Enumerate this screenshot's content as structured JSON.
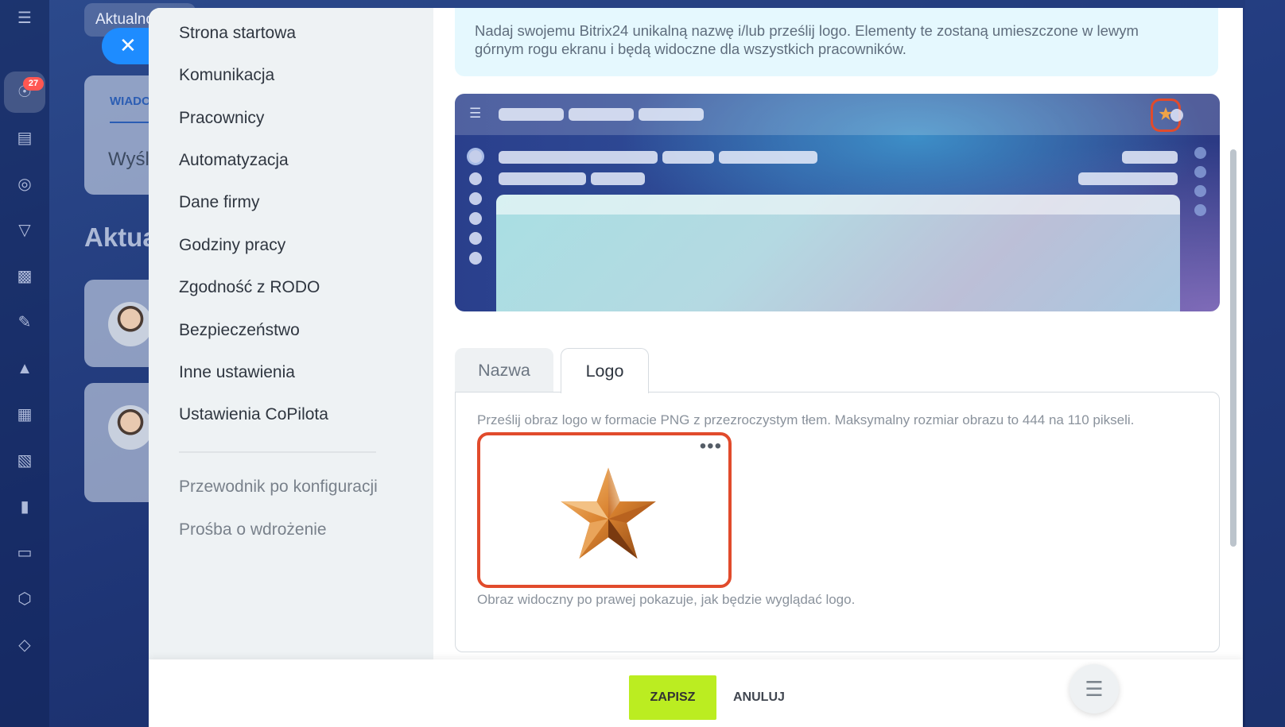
{
  "background": {
    "chip_label": "Aktualności",
    "card_tab_label": "WIADOMOŚCI",
    "card_text": "Wyślij wiadomość",
    "heading": "Aktualności",
    "notification_count": "27"
  },
  "menu": {
    "items": [
      "Strona startowa",
      "Komunikacja",
      "Pracownicy",
      "Automatyzacja",
      "Dane firmy",
      "Godziny pracy",
      "Zgodność z RODO",
      "Bezpieczeństwo",
      "Inne ustawienia",
      "Ustawienia CoPilota"
    ],
    "secondary_items": [
      "Przewodnik po konfiguracji",
      "Prośba o wdrożenie"
    ]
  },
  "info": {
    "text": "Nadaj swojemu Bitrix24 unikalną nazwę i/lub prześlij logo. Elementy te zostaną umieszczone w lewym górnym rogu ekranu i będą widoczne dla wszystkich pracowników."
  },
  "tabs": [
    {
      "label": "Nazwa",
      "active": false
    },
    {
      "label": "Logo",
      "active": true
    }
  ],
  "logo_panel": {
    "hint": "Prześlij obraz logo w formacie PNG z przezroczystym tłem. Maksymalny rozmiar obrazu to 444 na 110 pikseli.",
    "preview_note": "Obraz widoczny po prawej pokazuje, jak będzie wyglądać logo.",
    "menu_glyph": "•••"
  },
  "footer": {
    "save_label": "ZAPISZ",
    "cancel_label": "ANULUJ"
  },
  "icons": {
    "close": "close-icon",
    "menu": "hamburger-icon",
    "fab": "list-icon",
    "logo": "star-icon"
  },
  "colors": {
    "accent_save": "#bbed21",
    "highlight": "#e14b2c",
    "close_button": "#1e8cff",
    "info_bg": "#e5f8fe"
  }
}
